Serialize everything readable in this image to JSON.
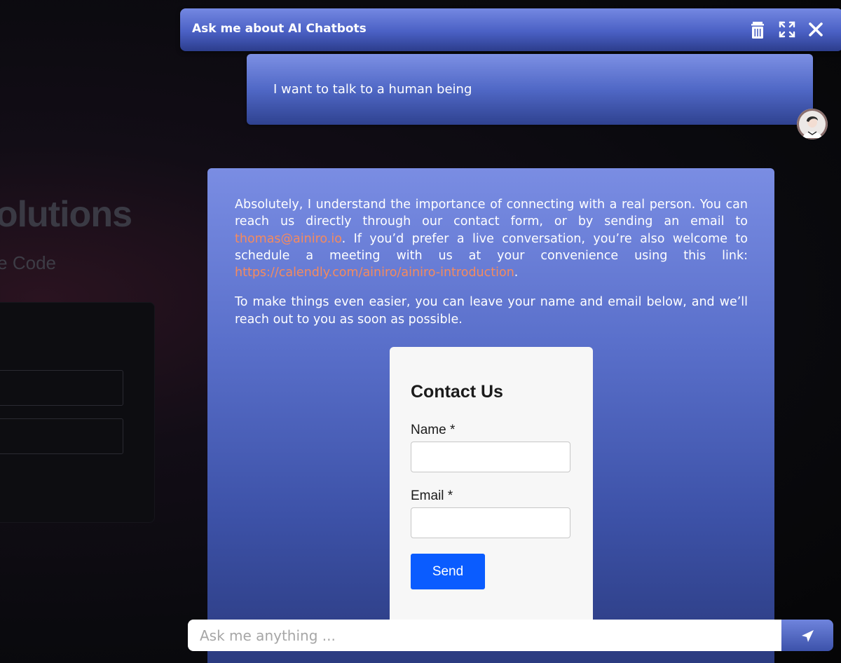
{
  "background_page": {
    "headline": "olutions",
    "subtitle": "e Code"
  },
  "chat": {
    "title": "Ask me about AI Chatbots",
    "header_icons": [
      "trash-icon",
      "expand-icon",
      "close-icon"
    ],
    "user_message": "I want to talk to a human being",
    "bot_message": {
      "p1_part1": "Absolutely, I understand the importance of connecting with a real person. You can reach us directly through our contact form, or by sending an email to ",
      "email_link": "thomas@ainiro.io",
      "p1_part2": ". If you’d prefer a live conversation, you’re also welcome to schedule a meeting with us at your convenience using this link: ",
      "calendly_link": "https://calendly.com/ainiro/ainiro-introduction",
      "p1_part3": ".",
      "p2": "To make things even easier, you can leave your name and email below, and we’ll reach out to you as soon as possible."
    },
    "contact_form": {
      "title": "Contact Us",
      "name_label": "Name *",
      "email_label": "Email *",
      "name_value": "",
      "email_value": "",
      "send_label": "Send"
    },
    "input": {
      "placeholder": "Ask me anything ...",
      "value": ""
    }
  },
  "colors": {
    "header_gradient_top": "#7488e2",
    "header_gradient_bottom": "#2c3d8c",
    "link_color": "#f58a5e",
    "send_button": "#0a5cff"
  }
}
